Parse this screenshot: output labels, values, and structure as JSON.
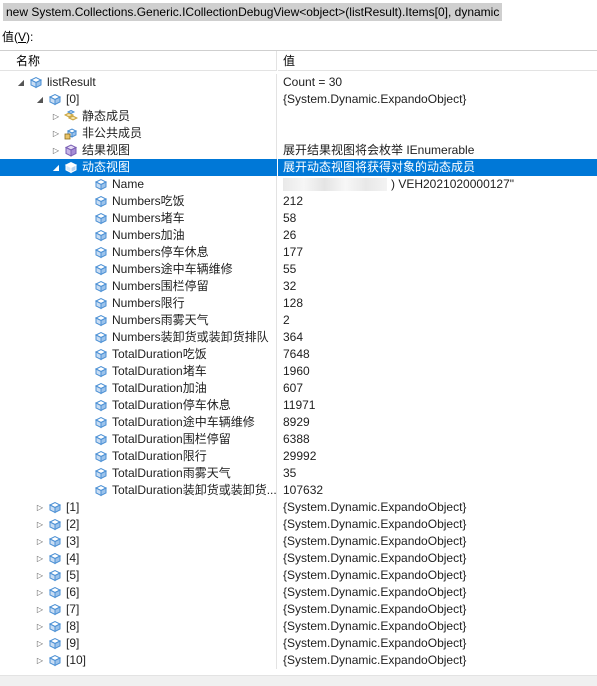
{
  "expression": "new System.Collections.Generic.ICollectionDebugView<object>(listResult).Items[0], dynamic",
  "values_label": {
    "text_before": "值(",
    "mnemonic": "V",
    "text_after": "):"
  },
  "columns": {
    "name": "名称",
    "value": "值"
  },
  "rows": [
    {
      "level": 0,
      "expander": "expanded",
      "icon": "field-icon",
      "name": "listResult",
      "value": "Count = 30"
    },
    {
      "level": 1,
      "expander": "expanded",
      "icon": "field-icon",
      "name": "[0]",
      "value": "{System.Dynamic.ExpandoObject}"
    },
    {
      "level": 2,
      "expander": "collapsed",
      "icon": "static-members-icon",
      "name": "静态成员",
      "value": ""
    },
    {
      "level": 2,
      "expander": "collapsed",
      "icon": "non-public-members-icon",
      "name": "非公共成员",
      "value": ""
    },
    {
      "level": 2,
      "expander": "collapsed",
      "icon": "results-view-icon",
      "name": "结果视图",
      "value": "展开结果视图将会枚举 IEnumerable"
    },
    {
      "level": 2,
      "expander": "expanded",
      "icon": "dynamic-view-icon",
      "name": "动态视图",
      "value": "展开动态视图将获得对象的动态成员",
      "selected": true
    },
    {
      "level": 3,
      "expander": "none",
      "icon": "field-icon",
      "name": "Name",
      "value": ") VEH2021020000127\"",
      "redacted": true
    },
    {
      "level": 3,
      "expander": "none",
      "icon": "field-icon",
      "name": "Numbers吃饭",
      "value": "212"
    },
    {
      "level": 3,
      "expander": "none",
      "icon": "field-icon",
      "name": "Numbers堵车",
      "value": "58"
    },
    {
      "level": 3,
      "expander": "none",
      "icon": "field-icon",
      "name": "Numbers加油",
      "value": "26"
    },
    {
      "level": 3,
      "expander": "none",
      "icon": "field-icon",
      "name": "Numbers停车休息",
      "value": "177"
    },
    {
      "level": 3,
      "expander": "none",
      "icon": "field-icon",
      "name": "Numbers途中车辆维修",
      "value": "55"
    },
    {
      "level": 3,
      "expander": "none",
      "icon": "field-icon",
      "name": "Numbers围栏停留",
      "value": "32"
    },
    {
      "level": 3,
      "expander": "none",
      "icon": "field-icon",
      "name": "Numbers限行",
      "value": "128"
    },
    {
      "level": 3,
      "expander": "none",
      "icon": "field-icon",
      "name": "Numbers雨雾天气",
      "value": "2"
    },
    {
      "level": 3,
      "expander": "none",
      "icon": "field-icon",
      "name": "Numbers装卸货或装卸货排队",
      "value": "364"
    },
    {
      "level": 3,
      "expander": "none",
      "icon": "field-icon",
      "name": "TotalDuration吃饭",
      "value": "7648"
    },
    {
      "level": 3,
      "expander": "none",
      "icon": "field-icon",
      "name": "TotalDuration堵车",
      "value": "1960"
    },
    {
      "level": 3,
      "expander": "none",
      "icon": "field-icon",
      "name": "TotalDuration加油",
      "value": "607"
    },
    {
      "level": 3,
      "expander": "none",
      "icon": "field-icon",
      "name": "TotalDuration停车休息",
      "value": "11971"
    },
    {
      "level": 3,
      "expander": "none",
      "icon": "field-icon",
      "name": "TotalDuration途中车辆维修",
      "value": "8929"
    },
    {
      "level": 3,
      "expander": "none",
      "icon": "field-icon",
      "name": "TotalDuration围栏停留",
      "value": "6388"
    },
    {
      "level": 3,
      "expander": "none",
      "icon": "field-icon",
      "name": "TotalDuration限行",
      "value": "29992"
    },
    {
      "level": 3,
      "expander": "none",
      "icon": "field-icon",
      "name": "TotalDuration雨雾天气",
      "value": "35"
    },
    {
      "level": 3,
      "expander": "none",
      "icon": "field-icon",
      "name": "TotalDuration装卸货或装卸货...",
      "value": "107632"
    },
    {
      "level": 1,
      "expander": "collapsed",
      "icon": "field-icon",
      "name": "[1]",
      "value": "{System.Dynamic.ExpandoObject}"
    },
    {
      "level": 1,
      "expander": "collapsed",
      "icon": "field-icon",
      "name": "[2]",
      "value": "{System.Dynamic.ExpandoObject}"
    },
    {
      "level": 1,
      "expander": "collapsed",
      "icon": "field-icon",
      "name": "[3]",
      "value": "{System.Dynamic.ExpandoObject}"
    },
    {
      "level": 1,
      "expander": "collapsed",
      "icon": "field-icon",
      "name": "[4]",
      "value": "{System.Dynamic.ExpandoObject}"
    },
    {
      "level": 1,
      "expander": "collapsed",
      "icon": "field-icon",
      "name": "[5]",
      "value": "{System.Dynamic.ExpandoObject}"
    },
    {
      "level": 1,
      "expander": "collapsed",
      "icon": "field-icon",
      "name": "[6]",
      "value": "{System.Dynamic.ExpandoObject}"
    },
    {
      "level": 1,
      "expander": "collapsed",
      "icon": "field-icon",
      "name": "[7]",
      "value": "{System.Dynamic.ExpandoObject}"
    },
    {
      "level": 1,
      "expander": "collapsed",
      "icon": "field-icon",
      "name": "[8]",
      "value": "{System.Dynamic.ExpandoObject}"
    },
    {
      "level": 1,
      "expander": "collapsed",
      "icon": "field-icon",
      "name": "[9]",
      "value": "{System.Dynamic.ExpandoObject}"
    },
    {
      "level": 1,
      "expander": "collapsed",
      "icon": "field-icon",
      "name": "[10]",
      "value": "{System.Dynamic.ExpandoObject}"
    }
  ],
  "colors": {
    "selection": "#0078d7",
    "icon_blue": "#4a8fd4",
    "static_icon": "#c8a23c",
    "results_icon": "#7a5fb4"
  }
}
